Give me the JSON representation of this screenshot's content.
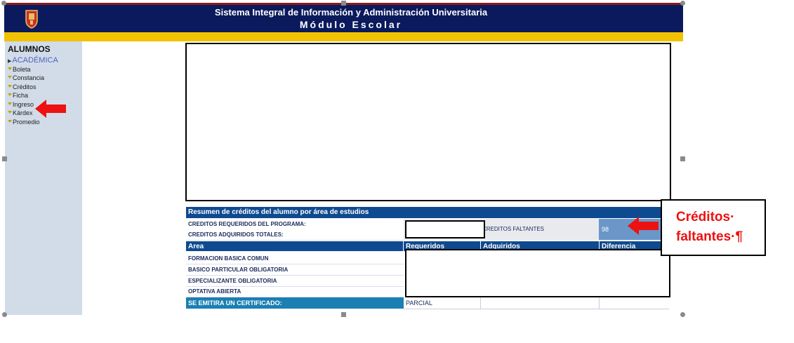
{
  "header": {
    "system_title": "Sistema Integral de Información y Administración Universitaria",
    "module_title": "Módulo Escolar",
    "logo_icon": "university-crest-icon"
  },
  "sidebar": {
    "title": "ALUMNOS",
    "section": "ACADÉMICA",
    "items": [
      {
        "label": "Boleta"
      },
      {
        "label": "Constancia"
      },
      {
        "label": "Créditos"
      },
      {
        "label": "Ficha"
      },
      {
        "label": "Ingreso"
      },
      {
        "label": "Kárdex"
      },
      {
        "label": "Promedio"
      }
    ]
  },
  "summary": {
    "title": "Resumen de créditos del alumno por área de estudios",
    "required_label": "CREDITOS REQUERIDOS DEL PROGRAMA:",
    "acquired_label": "CREDITOS ADQUIRIDOS TOTALES:",
    "missing_label": "CREDITOS FALTANTES",
    "missing_value": "98"
  },
  "area_table": {
    "columns": [
      "Area",
      "Requeridos",
      "Adquiridos",
      "Diferencia"
    ],
    "rows": [
      {
        "area": "FORMACION BASICA COMUN"
      },
      {
        "area": "BASICO PARTICULAR OBLIGATORIA"
      },
      {
        "area": "ESPECIALIZANTE OBLIGATORIA"
      },
      {
        "area": "OPTATIVA ABIERTA"
      }
    ],
    "certificate_label": "SE EMITIRA UN CERTIFICADO:",
    "certificate_value": "PARCIAL"
  },
  "callout": {
    "line1": "Créditos·",
    "line2": "faltantes·¶"
  },
  "colors": {
    "header_bg": "#0b1a5c",
    "gold_band": "#f2c200",
    "sidebar_bg": "#d1dce8",
    "table_header": "#0e4a8f",
    "certificate_row": "#1a7fb3",
    "arrow": "#ee1111"
  }
}
